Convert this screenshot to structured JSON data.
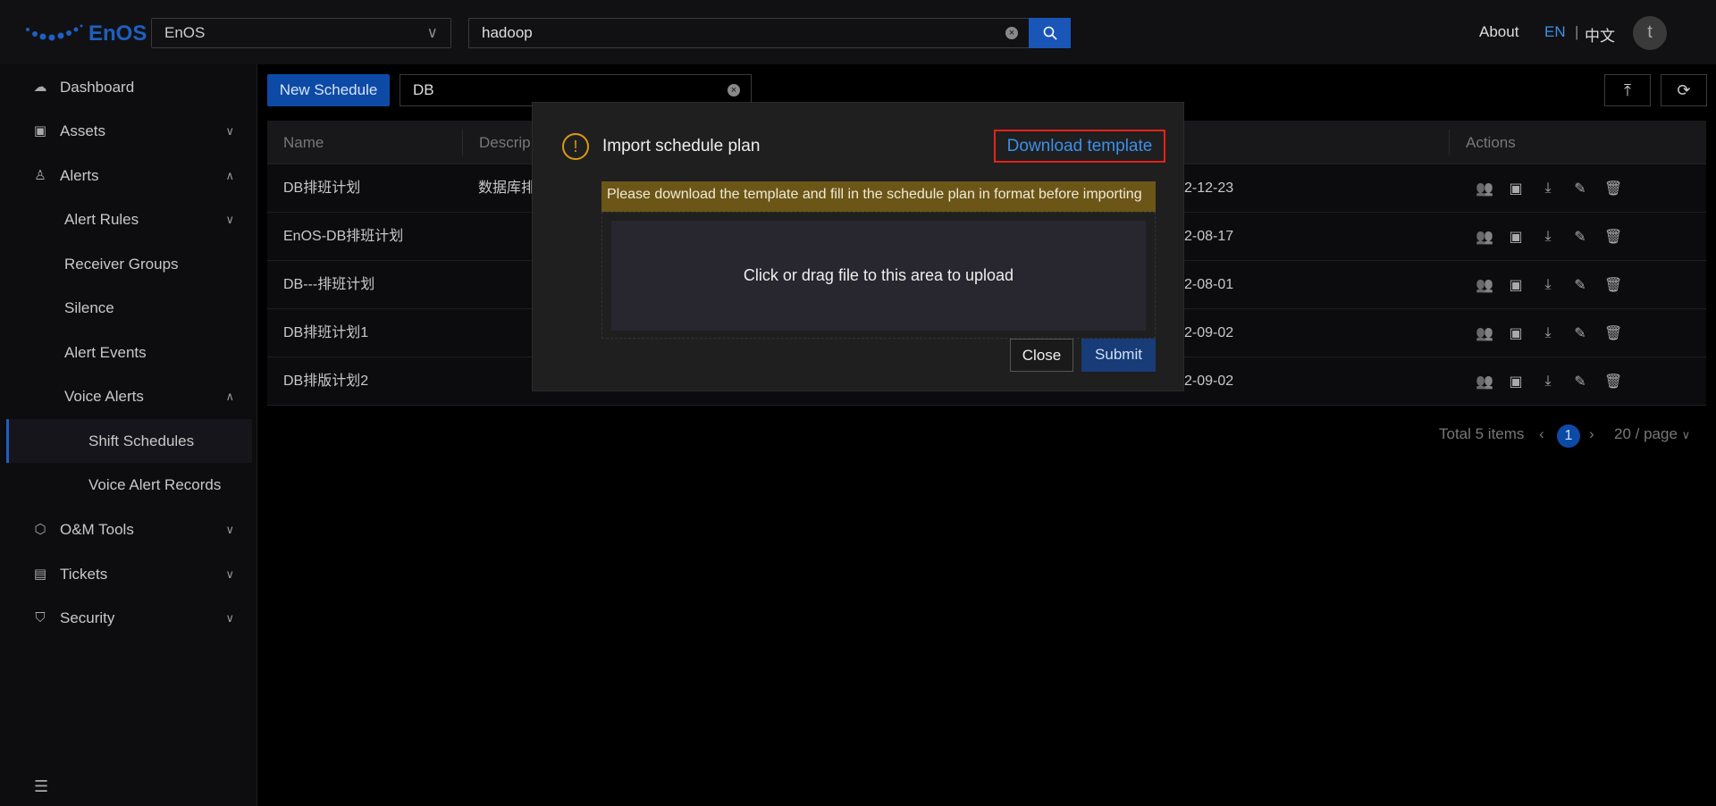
{
  "topbar": {
    "brand": "EnOS",
    "org_select": "EnOS",
    "search_value": "hadoop",
    "about": "About",
    "lang_en": "EN",
    "lang_zh": "中文",
    "avatar_initial": "t"
  },
  "sidebar": {
    "items": [
      {
        "label": "Dashboard",
        "icon": "cloud-upload-icon"
      },
      {
        "label": "Assets",
        "icon": "assets-icon"
      },
      {
        "label": "Alerts",
        "icon": "alarm-icon"
      },
      {
        "label": "Alert Rules"
      },
      {
        "label": "Receiver Groups"
      },
      {
        "label": "Silence"
      },
      {
        "label": "Alert Events"
      },
      {
        "label": "Voice Alerts"
      },
      {
        "label": "Shift Schedules"
      },
      {
        "label": "Voice Alert Records"
      },
      {
        "label": "O&M Tools",
        "icon": "tools-icon"
      },
      {
        "label": "Tickets",
        "icon": "ticket-icon"
      },
      {
        "label": "Security",
        "icon": "shield-icon"
      }
    ]
  },
  "toolbar": {
    "new_label": "New Schedule",
    "filter_value": "DB"
  },
  "table": {
    "headers": {
      "name": "Name",
      "description": "Descrip",
      "actions": "Actions"
    },
    "rows": [
      {
        "name": "DB排班计划",
        "description": "数据库排",
        "date": "2-12-23"
      },
      {
        "name": "EnOS-DB排班计划",
        "description": "",
        "date": "2-08-17"
      },
      {
        "name": "DB---排班计划",
        "description": "",
        "date": "2-08-01"
      },
      {
        "name": "DB排班计划1",
        "description": "",
        "date": "2-09-02"
      },
      {
        "name": "DB排版计划2",
        "description": "",
        "date": "2-09-02"
      }
    ]
  },
  "pagination": {
    "total": "Total 5 items",
    "current": "1",
    "page_size": "20 / page"
  },
  "modal": {
    "title": "Import schedule plan",
    "download": "Download template",
    "note": "Please download the template and fill in the schedule plan in format before importing",
    "drop_text": "Click or drag file to this area to upload",
    "close": "Close",
    "submit": "Submit"
  },
  "colors": {
    "accent": "#0d4aa6",
    "link": "#3d8fe8",
    "warning": "#d89a14",
    "highlight_border": "#e5221a"
  }
}
